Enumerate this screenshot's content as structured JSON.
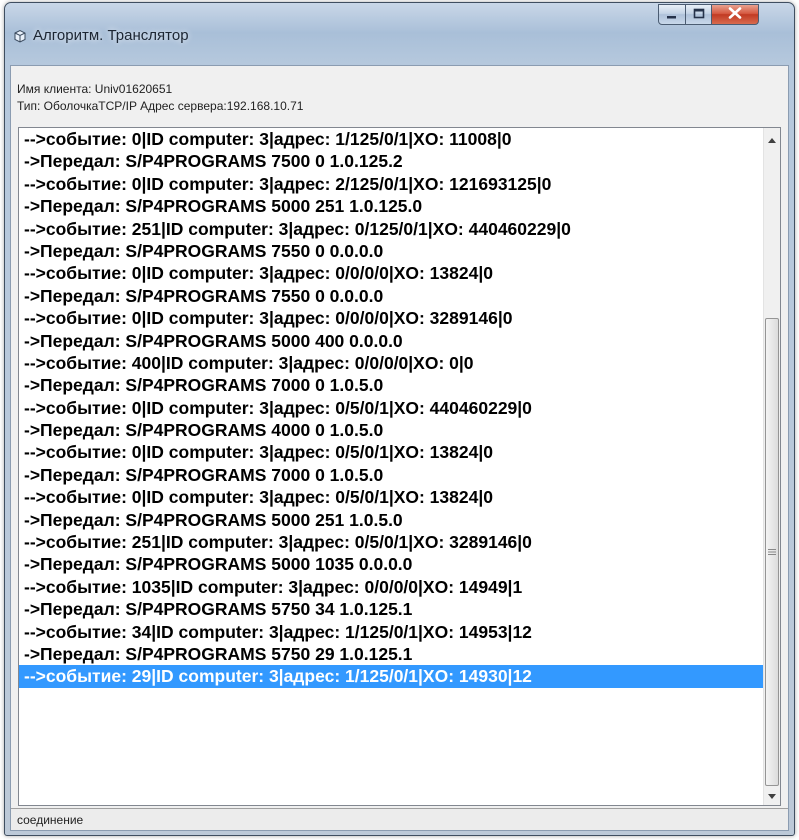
{
  "window": {
    "title": "Алгоритм. Транслятор",
    "icon": "cube-icon",
    "controls": {
      "minimize": "minimize-icon",
      "maximize": "maximize-icon",
      "close": "close-icon"
    }
  },
  "info": {
    "client_line": "Имя клиента: Univ01620651",
    "type_line": "Тип: ОболочкаTCP/IP Адрес сервера:192.168.10.71"
  },
  "log": {
    "rows": [
      "-->событие: 0|ID computer: 3|адрес: 1/125/0/1|XO: 11008|0",
      "->Передал: S/P4PROGRAMS 7500 0 1.0.125.2",
      "-->событие: 0|ID computer: 3|адрес: 2/125/0/1|XO: 121693125|0",
      "->Передал: S/P4PROGRAMS 5000 251 1.0.125.0",
      "-->событие: 251|ID computer: 3|адрес: 0/125/0/1|XO: 440460229|0",
      "->Передал: S/P4PROGRAMS 7550 0 0.0.0.0",
      "-->событие: 0|ID computer: 3|адрес: 0/0/0/0|XO: 13824|0",
      "->Передал: S/P4PROGRAMS 7550 0 0.0.0.0",
      "-->событие: 0|ID computer: 3|адрес: 0/0/0/0|XO: 3289146|0",
      "->Передал: S/P4PROGRAMS 5000 400 0.0.0.0",
      "-->событие: 400|ID computer: 3|адрес: 0/0/0/0|XO: 0|0",
      "->Передал: S/P4PROGRAMS 7000 0 1.0.5.0",
      "-->событие: 0|ID computer: 3|адрес: 0/5/0/1|XO: 440460229|0",
      "->Передал: S/P4PROGRAMS 4000 0 1.0.5.0",
      "-->событие: 0|ID computer: 3|адрес: 0/5/0/1|XO: 13824|0",
      "->Передал: S/P4PROGRAMS 7000 0 1.0.5.0",
      "-->событие: 0|ID computer: 3|адрес: 0/5/0/1|XO: 13824|0",
      "->Передал: S/P4PROGRAMS 5000 251 1.0.5.0",
      "-->событие: 251|ID computer: 3|адрес: 0/5/0/1|XO: 3289146|0",
      "->Передал: S/P4PROGRAMS 5000 1035 0.0.0.0",
      "-->событие: 1035|ID computer: 3|адрес: 0/0/0/0|XO: 14949|1",
      "->Передал: S/P4PROGRAMS 5750 34 1.0.125.1",
      "-->событие: 34|ID computer: 3|адрес: 1/125/0/1|XO: 14953|12",
      "->Передал: S/P4PROGRAMS 5750 29 1.0.125.1",
      "-->событие: 29|ID computer: 3|адрес: 1/125/0/1|XO: 14930|12"
    ],
    "selected_index": 24
  },
  "status": {
    "text": "соединение"
  },
  "colors": {
    "selection": "#3399ff",
    "selection_text": "#ffffff"
  }
}
